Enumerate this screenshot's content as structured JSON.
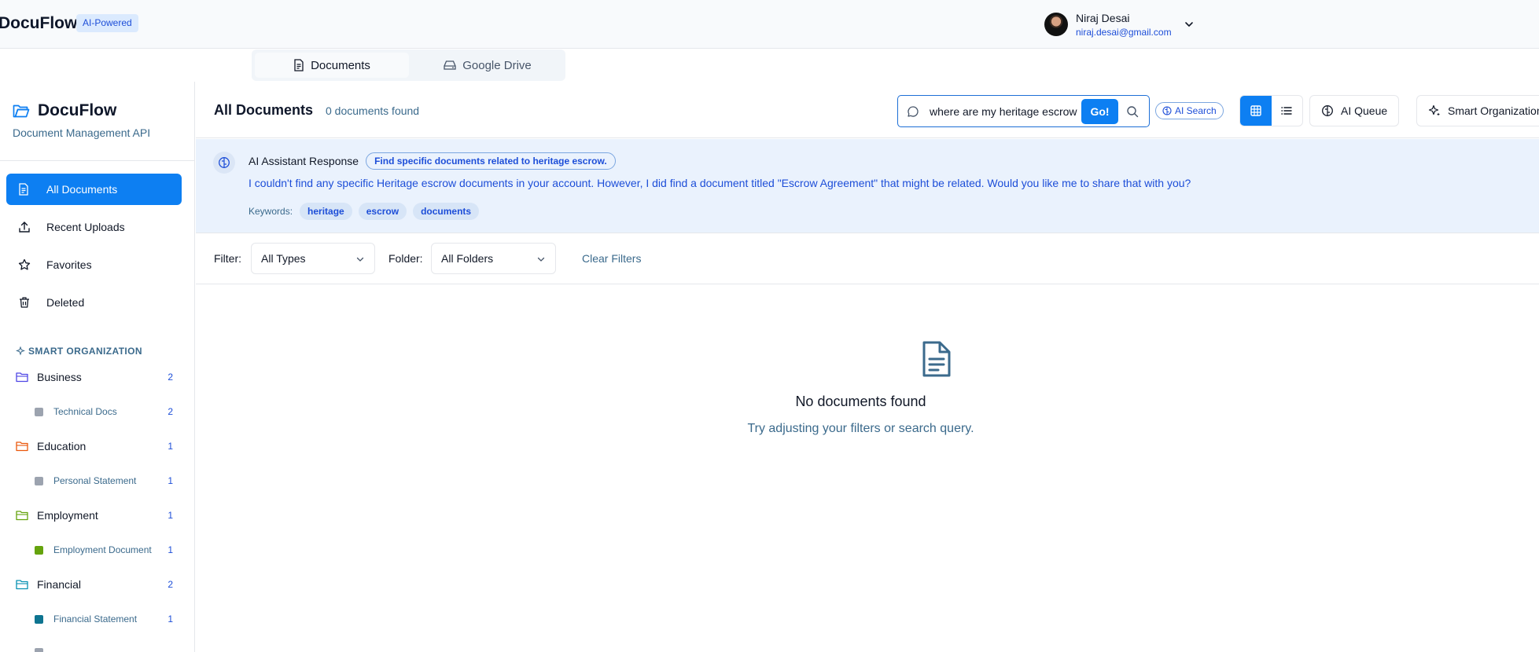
{
  "topbar": {
    "brand": "DocuFlow",
    "badge": "AI-Powered",
    "user": {
      "name": "Niraj Desai",
      "email": "niraj.desai@gmail.com"
    }
  },
  "tabs": [
    {
      "label": "Documents",
      "icon": "file-icon",
      "active": true
    },
    {
      "label": "Google Drive",
      "icon": "drive-icon",
      "active": false
    }
  ],
  "sidebar": {
    "brand": "DocuFlow",
    "subtitle": "Document Management API",
    "nav": [
      {
        "label": "All Documents",
        "icon": "file-icon",
        "active": true
      },
      {
        "label": "Recent Uploads",
        "icon": "upload-icon",
        "active": false
      },
      {
        "label": "Favorites",
        "icon": "star-icon",
        "active": false
      },
      {
        "label": "Deleted",
        "icon": "trash-icon",
        "active": false
      }
    ],
    "smart_title": "SMART ORGANIZATION",
    "categories": [
      {
        "label": "Business",
        "count": "2",
        "color": "#4f46e5",
        "sub": {
          "label": "Technical Docs",
          "count": "2",
          "color": "#9ca3af"
        }
      },
      {
        "label": "Education",
        "count": "1",
        "color": "#ea580c",
        "sub": {
          "label": "Personal Statement",
          "count": "1",
          "color": "#9ca3af"
        }
      },
      {
        "label": "Employment",
        "count": "1",
        "color": "#65a30d",
        "sub": {
          "label": "Employment Document",
          "count": "1",
          "color": "#65a30d"
        }
      },
      {
        "label": "Financial",
        "count": "2",
        "color": "#0891b2",
        "sub": {
          "label": "Financial Statement",
          "count": "1",
          "color": "#0e7490"
        }
      }
    ]
  },
  "main": {
    "title": "All Documents",
    "count": "0 documents found",
    "search": {
      "value": "where are my heritage escrow",
      "go": "Go!"
    },
    "ai_search": "AI Search",
    "ai_queue": "AI Queue",
    "smart_org": "Smart Organization"
  },
  "ai_response": {
    "title": "AI Assistant Response",
    "query_pill": "Find specific documents related to heritage escrow.",
    "body": "I couldn't find any specific Heritage escrow documents in your account. However, I did find a document titled \"Escrow Agreement\" that might be related. Would you like me to share that with you?",
    "keywords_label": "Keywords:",
    "keywords": [
      "heritage",
      "escrow",
      "documents"
    ]
  },
  "filters": {
    "filter_label": "Filter:",
    "filter_value": "All Types",
    "folder_label": "Folder:",
    "folder_value": "All Folders",
    "clear": "Clear Filters"
  },
  "empty": {
    "title": "No documents found",
    "hint": "Try adjusting your filters or search query."
  }
}
